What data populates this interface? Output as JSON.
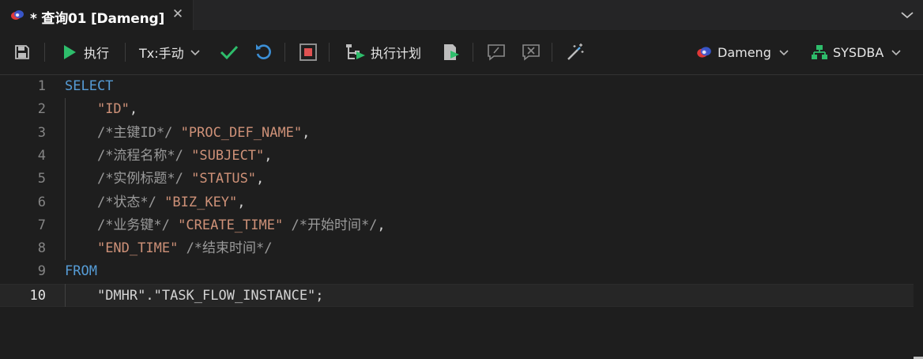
{
  "tab": {
    "title": "* 查询01 [Dameng]",
    "close_glyph": "✕",
    "icon": "dameng-logo-icon"
  },
  "toolbar": {
    "execute_label": "执行",
    "tx_label": "Tx:手动",
    "plan_label": "执行计划",
    "connection_label": "Dameng",
    "schema_label": "SYSDBA",
    "icons": [
      "save-icon",
      "run-icon",
      "chevron-down-icon",
      "commit-check-icon",
      "rollback-icon",
      "stop-icon",
      "execution-plan-icon",
      "export-icon",
      "comment-icon",
      "uncomment-icon",
      "magic-wand-icon",
      "dameng-logo-icon",
      "schema-icon"
    ],
    "colors": {
      "run": "#2ebd6b",
      "check": "#2ebd6b",
      "rollback": "#3c8fd6",
      "stop": "#e05252",
      "plan": "#2ebd6b"
    }
  },
  "editor": {
    "current_line": 10,
    "lines": [
      {
        "n": "1",
        "tokens": [
          {
            "t": "SELECT",
            "c": "kw"
          }
        ]
      },
      {
        "n": "2",
        "tokens": [
          {
            "t": "    ",
            "c": "plain"
          },
          {
            "t": "\"ID\"",
            "c": "str"
          },
          {
            "t": ",",
            "c": "plain"
          }
        ]
      },
      {
        "n": "3",
        "tokens": [
          {
            "t": "    ",
            "c": "plain"
          },
          {
            "t": "/*主键ID*/",
            "c": "cmt"
          },
          {
            "t": " ",
            "c": "plain"
          },
          {
            "t": "\"PROC_DEF_NAME\"",
            "c": "str"
          },
          {
            "t": ",",
            "c": "plain"
          }
        ]
      },
      {
        "n": "4",
        "tokens": [
          {
            "t": "    ",
            "c": "plain"
          },
          {
            "t": "/*流程名称*/",
            "c": "cmt"
          },
          {
            "t": " ",
            "c": "plain"
          },
          {
            "t": "\"SUBJECT\"",
            "c": "str"
          },
          {
            "t": ",",
            "c": "plain"
          }
        ]
      },
      {
        "n": "5",
        "tokens": [
          {
            "t": "    ",
            "c": "plain"
          },
          {
            "t": "/*实例标题*/",
            "c": "cmt"
          },
          {
            "t": " ",
            "c": "plain"
          },
          {
            "t": "\"STATUS\"",
            "c": "str"
          },
          {
            "t": ",",
            "c": "plain"
          }
        ]
      },
      {
        "n": "6",
        "tokens": [
          {
            "t": "    ",
            "c": "plain"
          },
          {
            "t": "/*状态*/",
            "c": "cmt"
          },
          {
            "t": " ",
            "c": "plain"
          },
          {
            "t": "\"BIZ_KEY\"",
            "c": "str"
          },
          {
            "t": ",",
            "c": "plain"
          }
        ]
      },
      {
        "n": "7",
        "tokens": [
          {
            "t": "    ",
            "c": "plain"
          },
          {
            "t": "/*业务键*/",
            "c": "cmt"
          },
          {
            "t": " ",
            "c": "plain"
          },
          {
            "t": "\"CREATE_TIME\"",
            "c": "str"
          },
          {
            "t": " ",
            "c": "plain"
          },
          {
            "t": "/*开始时间*/",
            "c": "cmt"
          },
          {
            "t": ",",
            "c": "plain"
          }
        ]
      },
      {
        "n": "8",
        "tokens": [
          {
            "t": "    ",
            "c": "plain"
          },
          {
            "t": "\"END_TIME\"",
            "c": "str"
          },
          {
            "t": " ",
            "c": "plain"
          },
          {
            "t": "/*结束时间*/",
            "c": "cmt"
          }
        ]
      },
      {
        "n": "9",
        "tokens": [
          {
            "t": "FROM",
            "c": "kw"
          }
        ]
      },
      {
        "n": "10",
        "tokens": [
          {
            "t": "    ",
            "c": "plain"
          },
          {
            "t": "\"DMHR\".\"TASK_FLOW_INSTANCE\";",
            "c": "plain"
          }
        ]
      }
    ]
  }
}
